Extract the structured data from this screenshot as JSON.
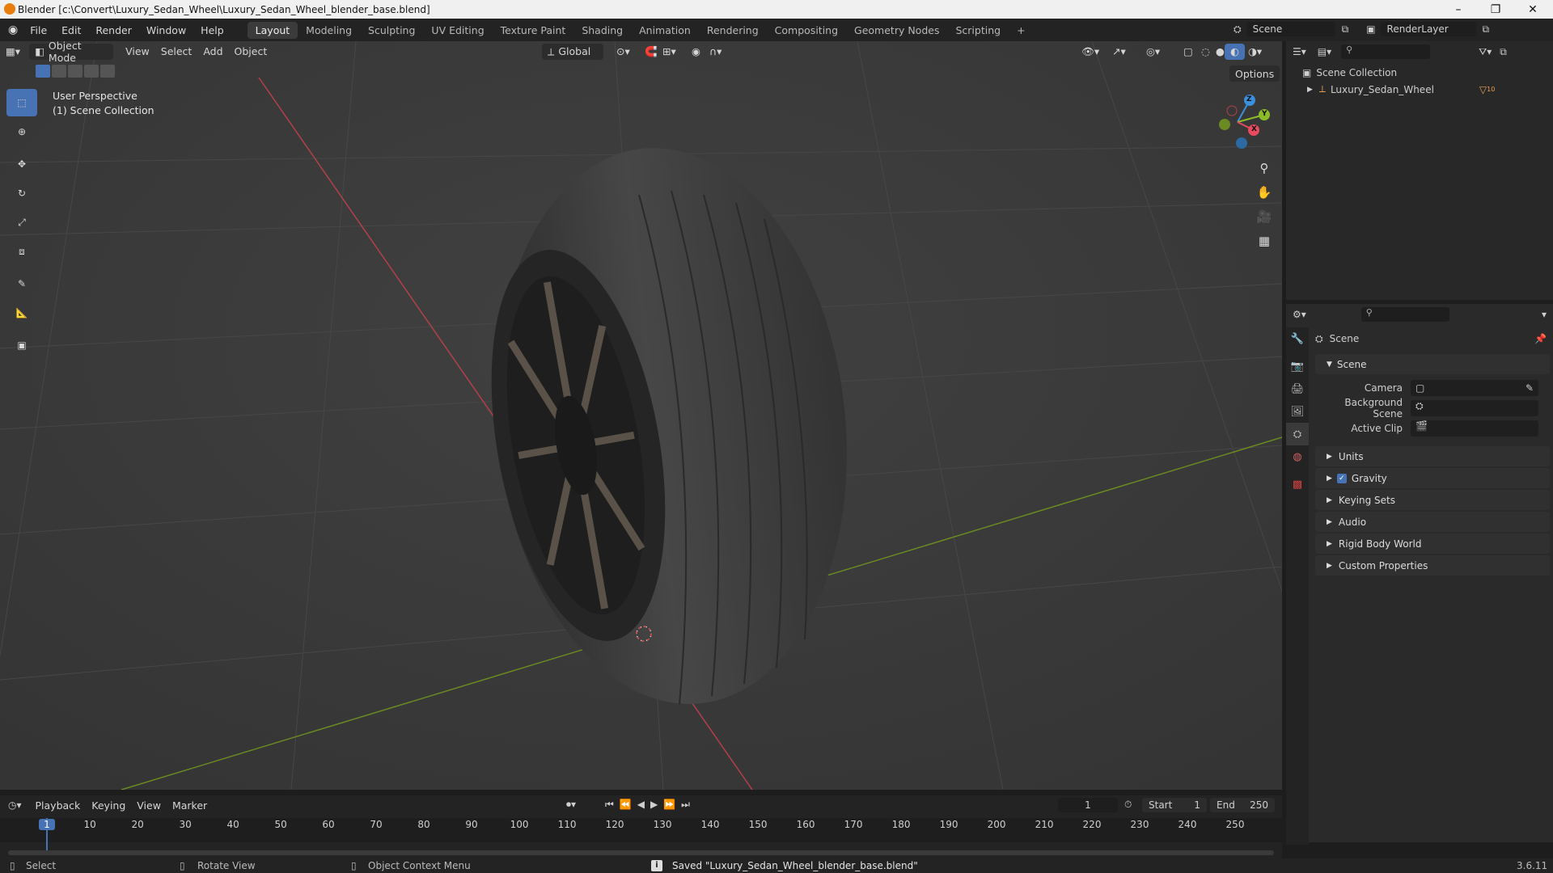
{
  "window": {
    "title": "Blender [c:\\Convert\\Luxury_Sedan_Wheel\\Luxury_Sedan_Wheel_blender_base.blend]",
    "minimize": "–",
    "maximize": "❐",
    "close": "✕"
  },
  "menus": [
    "File",
    "Edit",
    "Render",
    "Window",
    "Help"
  ],
  "workspaces": [
    "Layout",
    "Modeling",
    "Sculpting",
    "UV Editing",
    "Texture Paint",
    "Shading",
    "Animation",
    "Rendering",
    "Compositing",
    "Geometry Nodes",
    "Scripting",
    "+"
  ],
  "scene": {
    "label": "Scene",
    "renderlayer": "RenderLayer"
  },
  "viewport_header": {
    "mode": "Object Mode",
    "view": "View",
    "select": "Select",
    "add": "Add",
    "object": "Object",
    "orientation": "Global",
    "options": "Options"
  },
  "viewport": {
    "perspective": "User Perspective",
    "collection": "(1) Scene Collection",
    "gizmo": {
      "x": "X",
      "y": "Y",
      "z": "Z"
    }
  },
  "outliner": {
    "root": "Scene Collection",
    "item": "Luxury_Sedan_Wheel",
    "item_count": "10"
  },
  "properties": {
    "header": "Scene",
    "section_scene": "Scene",
    "camera_label": "Camera",
    "bg_scene_label": "Background Scene",
    "active_clip_label": "Active Clip",
    "sections": [
      "Units",
      "Gravity",
      "Keying Sets",
      "Audio",
      "Rigid Body World",
      "Custom Properties"
    ]
  },
  "timeline": {
    "playback": "Playback",
    "keying": "Keying",
    "view": "View",
    "marker": "Marker",
    "current_frame": "1",
    "start_label": "Start",
    "start": "1",
    "end_label": "End",
    "end": "250",
    "ticks": [
      "1",
      "10",
      "20",
      "30",
      "40",
      "50",
      "60",
      "70",
      "80",
      "90",
      "100",
      "110",
      "120",
      "130",
      "140",
      "150",
      "160",
      "170",
      "180",
      "190",
      "200",
      "210",
      "220",
      "230",
      "240",
      "250"
    ]
  },
  "statusbar": {
    "select": "Select",
    "rotate": "Rotate View",
    "context": "Object Context Menu",
    "message": "Saved \"Luxury_Sedan_Wheel_blender_base.blend\"",
    "version": "3.6.11"
  },
  "colors": {
    "accent": "#4772b3",
    "x_axis": "#e84a5f",
    "y_axis": "#8cbb2a",
    "z_axis": "#3b8fdc"
  }
}
